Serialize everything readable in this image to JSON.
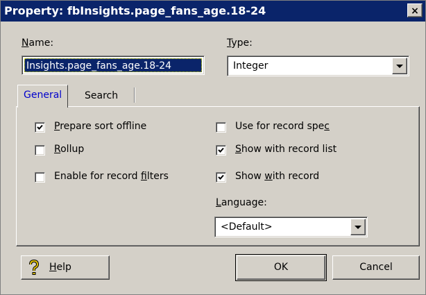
{
  "window": {
    "title": "Property: fbInsights.page_fans_age.18-24",
    "close_symbol": "×"
  },
  "name_field": {
    "label_key": "N",
    "label_rest": "ame:",
    "value": "Insights.page_fans_age.18-24"
  },
  "type_field": {
    "label_key": "T",
    "label_rest": "ype:",
    "value": "Integer"
  },
  "tabs": [
    {
      "label": "General",
      "active": true
    },
    {
      "label": "Search",
      "active": false
    }
  ],
  "options": {
    "prepare_sort": {
      "pre": "",
      "key": "P",
      "post": "repare sort offline",
      "checked": true
    },
    "rollup": {
      "pre": "",
      "key": "R",
      "post": "ollup",
      "checked": false
    },
    "record_filters": {
      "pre": "Enable for record ",
      "key": "f",
      "post": "ilters",
      "checked": false
    },
    "record_spec": {
      "pre": "Use for record spe",
      "key": "c",
      "post": "",
      "checked": false
    },
    "record_list": {
      "pre": "",
      "key": "S",
      "post": "how with record list",
      "checked": true
    },
    "with_record": {
      "pre": "Show ",
      "key": "w",
      "post": "ith record",
      "checked": true
    }
  },
  "language": {
    "label_key": "L",
    "label_rest": "anguage:",
    "value": "<Default>"
  },
  "buttons": {
    "help_key": "H",
    "help_rest": "elp",
    "ok": "OK",
    "cancel": "Cancel"
  },
  "colors": {
    "titlebar": "#0a246a",
    "dialog_face": "#d4d0c8",
    "active_tab_text": "#0000cc",
    "help_icon": "#e0c000"
  }
}
